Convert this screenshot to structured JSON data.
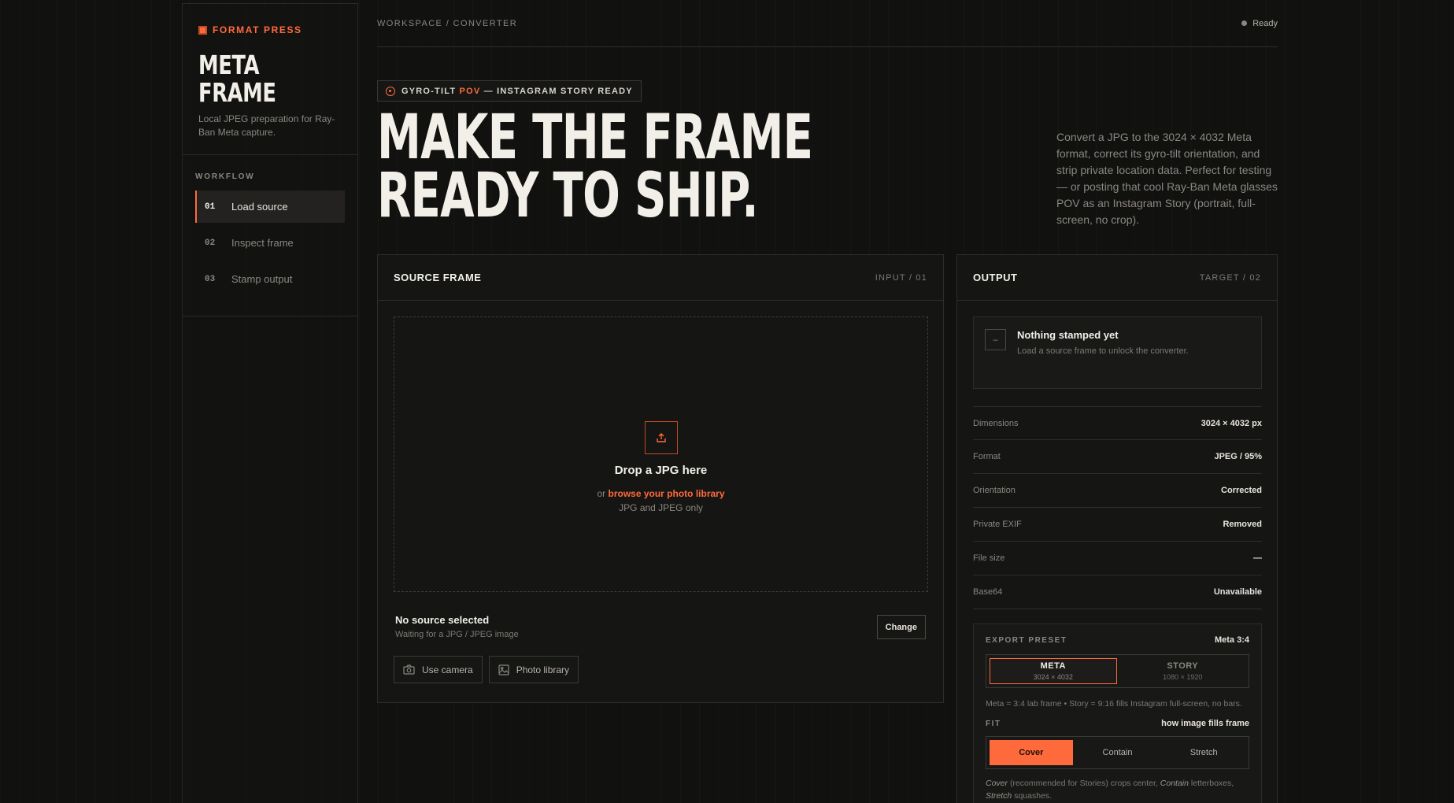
{
  "brand": {
    "name": "FORMAT PRESS",
    "title_line1": "META",
    "title_line2": "FRAME",
    "subtitle": "Local JPEG preparation for Ray-Ban Meta capture.",
    "accent_color": "#ff6a3d"
  },
  "workflow": {
    "label": "WORKFLOW",
    "items": [
      {
        "num": "01",
        "label": "Load source",
        "active": true
      },
      {
        "num": "02",
        "label": "Inspect frame",
        "active": false
      },
      {
        "num": "03",
        "label": "Stamp output",
        "active": false
      }
    ]
  },
  "topbar": {
    "breadcrumb": "WORKSPACE / CONVERTER",
    "status": "Ready"
  },
  "hero": {
    "badge_pre": "GYRO-TILT",
    "badge_accent": "POV",
    "badge_post": "— INSTAGRAM STORY READY",
    "title_line1": "MAKE THE FRAME",
    "title_line2": "READY TO SHIP.",
    "description": "Convert a JPG to the 3024 × 4032 Meta format, correct its gyro-tilt orientation, and strip private location data. Perfect for testing — or posting that cool Ray-Ban Meta glasses POV as an Instagram Story (portrait, full-screen, no crop)."
  },
  "source": {
    "title": "SOURCE FRAME",
    "tag": "INPUT / 01",
    "drop_title": "Drop a JPG here",
    "drop_or": "or",
    "drop_link": "browse your photo library",
    "drop_hint": "JPG and JPEG only",
    "status_title": "No source selected",
    "status_sub": "Waiting for a JPG / JPEG image",
    "change_label": "Change",
    "camera_label": "Use camera",
    "library_label": "Photo library"
  },
  "output": {
    "title": "OUTPUT",
    "tag": "TARGET / 02",
    "empty_icon": "–",
    "empty_title": "Nothing stamped yet",
    "empty_sub": "Load a source frame to unlock the converter.",
    "specs": [
      {
        "key": "Dimensions",
        "value": "3024 × 4032 px"
      },
      {
        "key": "Format",
        "value": "JPEG / 95%"
      },
      {
        "key": "Orientation",
        "value": "Corrected"
      },
      {
        "key": "Private EXIF",
        "value": "Removed"
      },
      {
        "key": "File size",
        "value": "—"
      },
      {
        "key": "Base64",
        "value": "Unavailable"
      }
    ],
    "preset": {
      "label": "EXPORT PRESET",
      "value": "Meta 3:4",
      "options": [
        {
          "name": "META",
          "dims": "3024 × 4032",
          "selected": true
        },
        {
          "name": "STORY",
          "dims": "1080 × 1920",
          "selected": false
        }
      ],
      "note": "Meta = 3:4 lab frame • Story = 9:16 fills Instagram full-screen, no bars."
    },
    "fit": {
      "label": "FIT",
      "hint": "how image fills frame",
      "options": [
        "Cover",
        "Contain",
        "Stretch"
      ],
      "selected": "Cover",
      "note_cover": "Cover",
      "note_1": "(recommended for Stories) crops center,",
      "note_contain": "Contain",
      "note_2": "letterboxes,",
      "note_stretch": "Stretch",
      "note_3": "squashes."
    }
  }
}
